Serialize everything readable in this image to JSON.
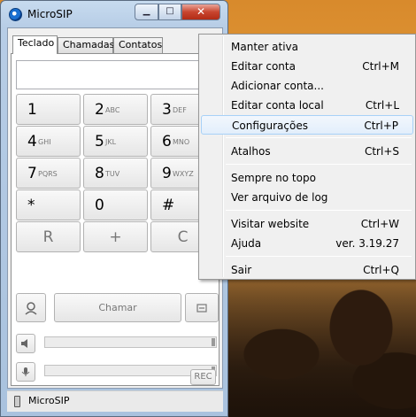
{
  "window": {
    "title": "MicroSIP",
    "controls": {
      "minimize": "▁",
      "maximize": "□",
      "close": "✕"
    }
  },
  "tabs": [
    "Teclado",
    "Chamadas",
    "Contatos"
  ],
  "keypad": [
    {
      "d": "1",
      "l": ""
    },
    {
      "d": "2",
      "l": "ABC"
    },
    {
      "d": "3",
      "l": "DEF"
    },
    {
      "d": "4",
      "l": "GHI"
    },
    {
      "d": "5",
      "l": "JKL"
    },
    {
      "d": "6",
      "l": "MNO"
    },
    {
      "d": "7",
      "l": "PQRS"
    },
    {
      "d": "8",
      "l": "TUV"
    },
    {
      "d": "9",
      "l": "WXYZ"
    },
    {
      "d": "*",
      "l": ""
    },
    {
      "d": "0",
      "l": ""
    },
    {
      "d": "#",
      "l": ""
    }
  ],
  "keypad_extra": [
    "R",
    "+",
    "C"
  ],
  "call_button": "Chamar",
  "rec_button": "REC",
  "status": "MicroSIP",
  "menu": {
    "items": [
      {
        "label": "Manter ativa",
        "shortcut": ""
      },
      {
        "label": "Editar conta",
        "shortcut": "Ctrl+M"
      },
      {
        "label": "Adicionar conta...",
        "shortcut": ""
      },
      {
        "label": "Editar conta local",
        "shortcut": "Ctrl+L"
      },
      {
        "label": "Configurações",
        "shortcut": "Ctrl+P"
      },
      {
        "label": "Atalhos",
        "shortcut": "Ctrl+S"
      },
      {
        "label": "Sempre no topo",
        "shortcut": ""
      },
      {
        "label": "Ver arquivo de log",
        "shortcut": ""
      },
      {
        "label": "Visitar website",
        "shortcut": "Ctrl+W"
      },
      {
        "label": "Ajuda",
        "shortcut": "ver. 3.19.27"
      },
      {
        "label": "Sair",
        "shortcut": "Ctrl+Q"
      }
    ],
    "highlighted": "Configurações"
  }
}
